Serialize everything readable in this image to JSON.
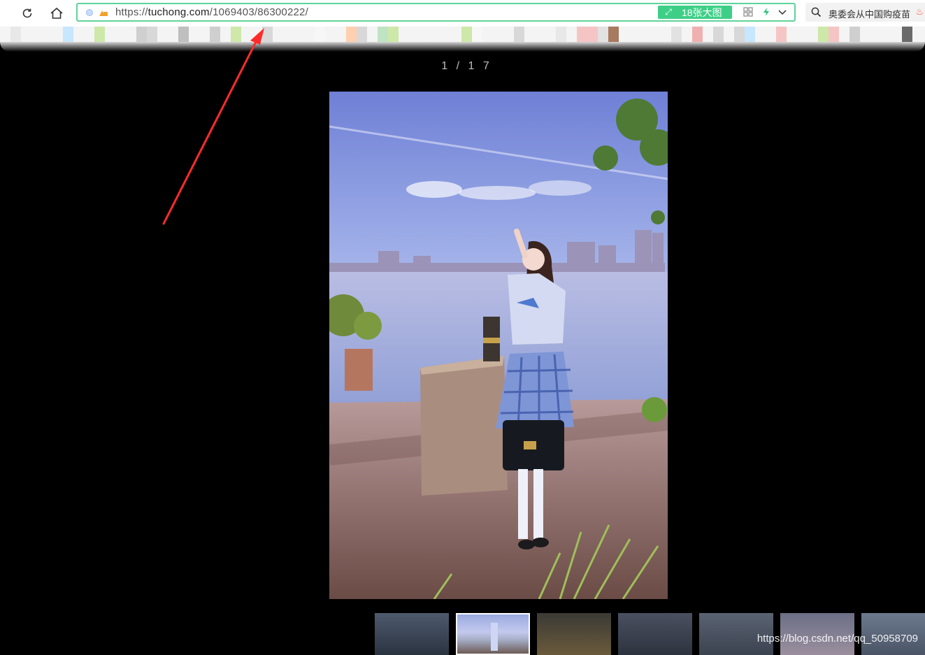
{
  "browser": {
    "url_prefix": "https://",
    "url_host": "tuchong.com",
    "url_path": "/1069403/86300222/",
    "bigpic_label": "18张大图",
    "search_text": "奥委会从中国购疫苗"
  },
  "viewer": {
    "counter": "1 / 1 7",
    "active_thumb_index": 1,
    "thumbnails": [
      "thumb-1",
      "thumb-2",
      "thumb-3",
      "thumb-4",
      "thumb-5",
      "thumb-6",
      "thumb-7"
    ]
  },
  "watermark": "https://blog.csdn.net/qq_50958709",
  "colors": {
    "address_border": "#5fd39a",
    "bigpic_bg": "#3ecf87",
    "annotation_arrow": "#ff2b2b",
    "page_bg": "#000000"
  },
  "icons": [
    "refresh-icon",
    "home-icon",
    "secure-icon",
    "expand-icon",
    "qr-icon",
    "bolt-icon",
    "chevron-down-icon",
    "search-icon",
    "hot-icon"
  ]
}
